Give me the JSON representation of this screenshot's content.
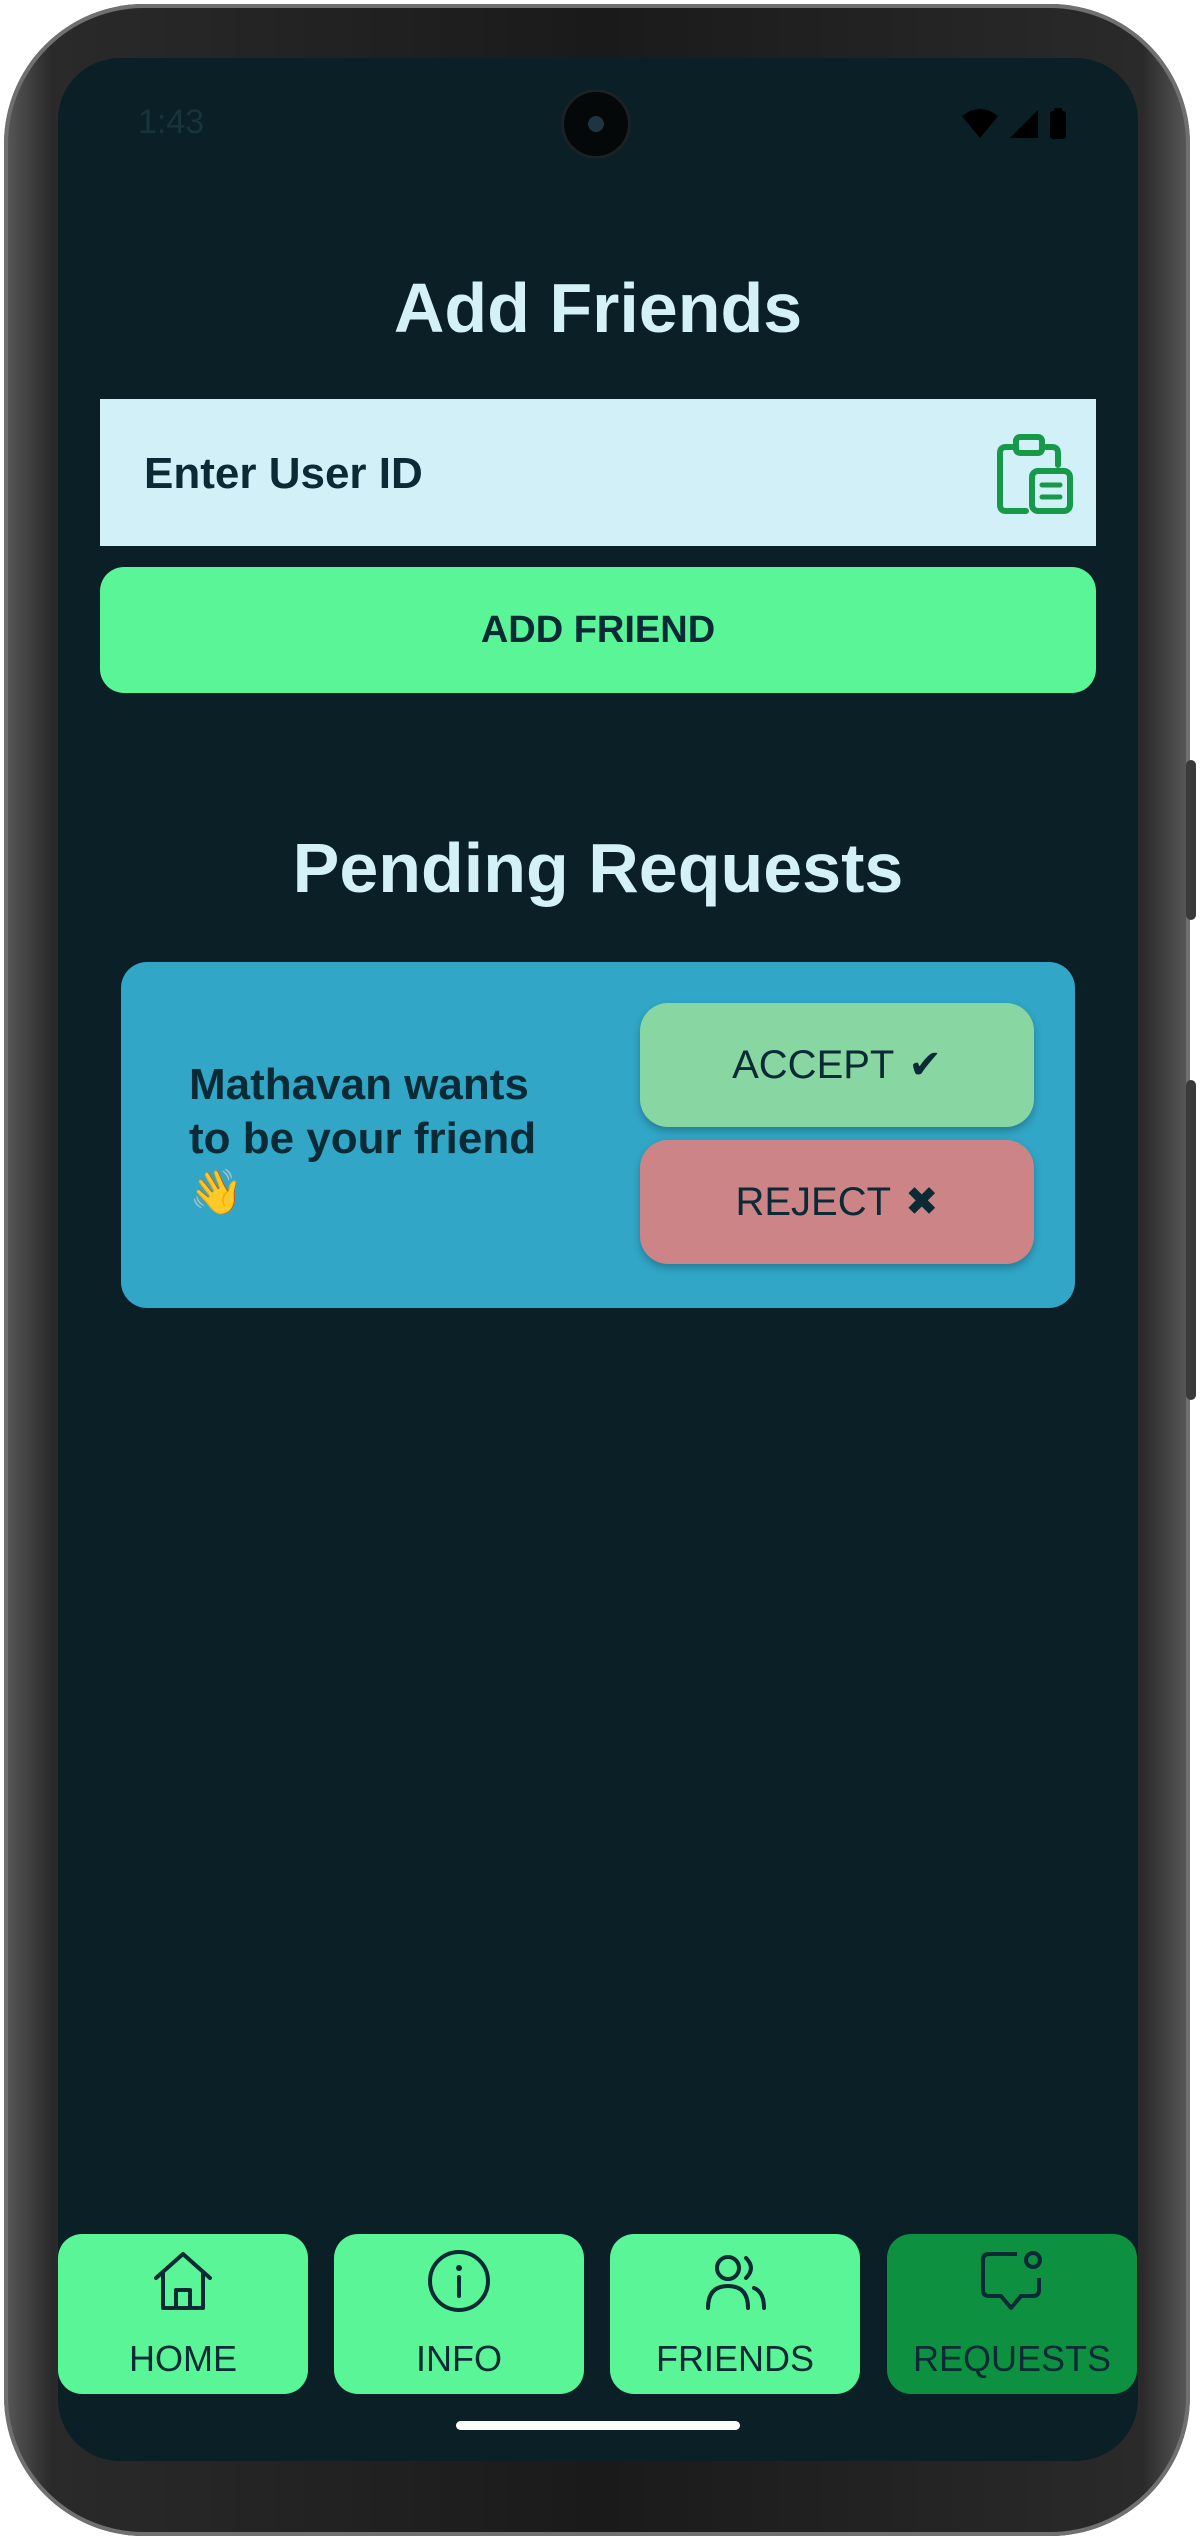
{
  "status_bar": {
    "time": "1:43"
  },
  "add_section": {
    "title": "Add Friends",
    "input_placeholder": "Enter User ID",
    "input_value": "",
    "add_button_label": "ADD FRIEND"
  },
  "pending_section": {
    "title": "Pending Requests",
    "requests": [
      {
        "message": "Mathavan wants to be your friend 👋",
        "accept_label": "ACCEPT",
        "accept_glyph": "✔",
        "reject_label": "REJECT",
        "reject_glyph": "✖"
      }
    ]
  },
  "bottom_nav": {
    "items": [
      {
        "label": "HOME",
        "icon": "home-icon",
        "active": false
      },
      {
        "label": "INFO",
        "icon": "info-icon",
        "active": false
      },
      {
        "label": "FRIENDS",
        "icon": "friends-icon",
        "active": false
      },
      {
        "label": "REQUESTS",
        "icon": "requests-icon",
        "active": true
      }
    ]
  },
  "colors": {
    "background": "#0a1f26",
    "accent_green": "#5af596",
    "active_green": "#0d9140",
    "card_blue": "#31a6c7",
    "accept_green": "#88d6a2",
    "reject_red": "#cc8487",
    "title_text": "#d4f1f7"
  }
}
